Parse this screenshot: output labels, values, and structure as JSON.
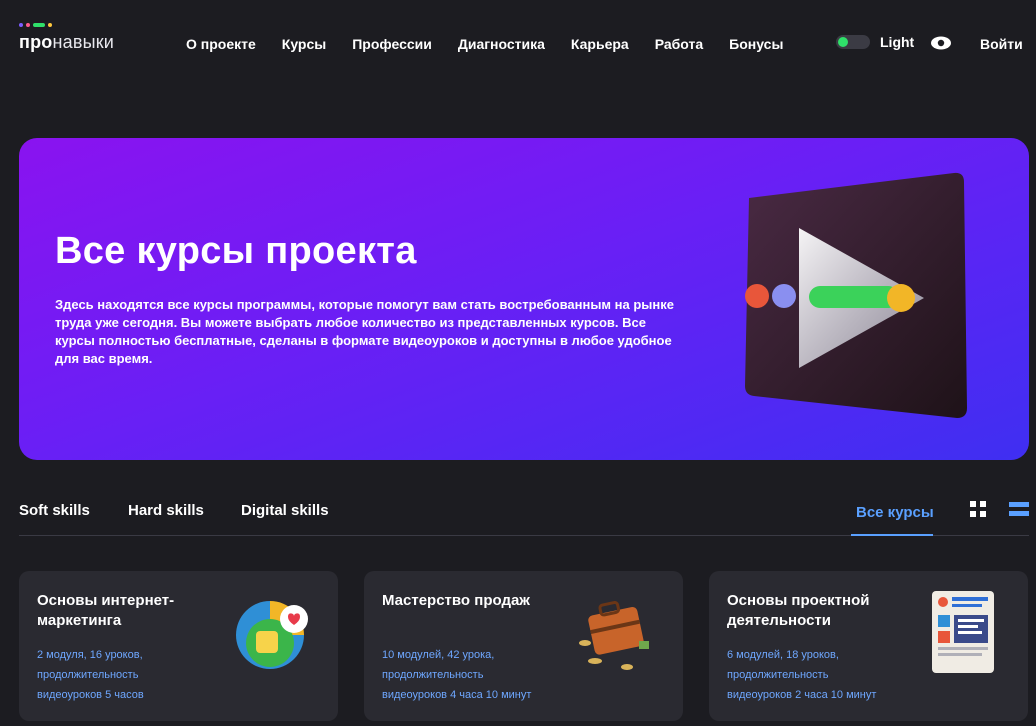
{
  "header": {
    "logo_bold": "про",
    "logo_rest": "навыки",
    "nav": [
      "О проекте",
      "Курсы",
      "Профессии",
      "Диагностика",
      "Карьера",
      "Работа",
      "Бонусы"
    ],
    "theme_label": "Light",
    "login_label": "Войти",
    "icons": {
      "eye": "eye-icon"
    }
  },
  "hero": {
    "title": "Все курсы проекта",
    "text": "Здесь находятся все курсы программы, которые помогут вам стать востребованным на рынке труда уже сегодня. Вы можете выбрать любое количество из представленных курсов. Все курсы полностью бесплатные, сделаны в формате видеоуроков и доступны в любое удобное для вас время."
  },
  "tabs": {
    "items": [
      "Soft skills",
      "Hard skills",
      "Digital skills"
    ],
    "all": "Все курсы"
  },
  "cards": [
    {
      "title": "Основы интернет-маркетинга",
      "meta_1": "2 модуля, 16 уроков,",
      "meta_2": "продолжительность",
      "meta_3": "видеоуроков 5 часов"
    },
    {
      "title": "Мастерство продаж",
      "meta_1": "10 модулей, 42 урока,",
      "meta_2": "продолжительность",
      "meta_3": "видеоуроков 4 часа 10 минут"
    },
    {
      "title": "Основы проектной деятельности",
      "meta_1": "6 модулей, 18 уроков,",
      "meta_2": "продолжительность",
      "meta_3": "видеоуроков 2 часа 10 минут"
    }
  ],
  "colors": {
    "background": "#1c1c21",
    "card": "#2a2a31",
    "accent": "#5aa0ff",
    "toggle_on": "#2fe06a",
    "hero_start": "#8a13f0",
    "hero_end": "#3f2ff2"
  }
}
